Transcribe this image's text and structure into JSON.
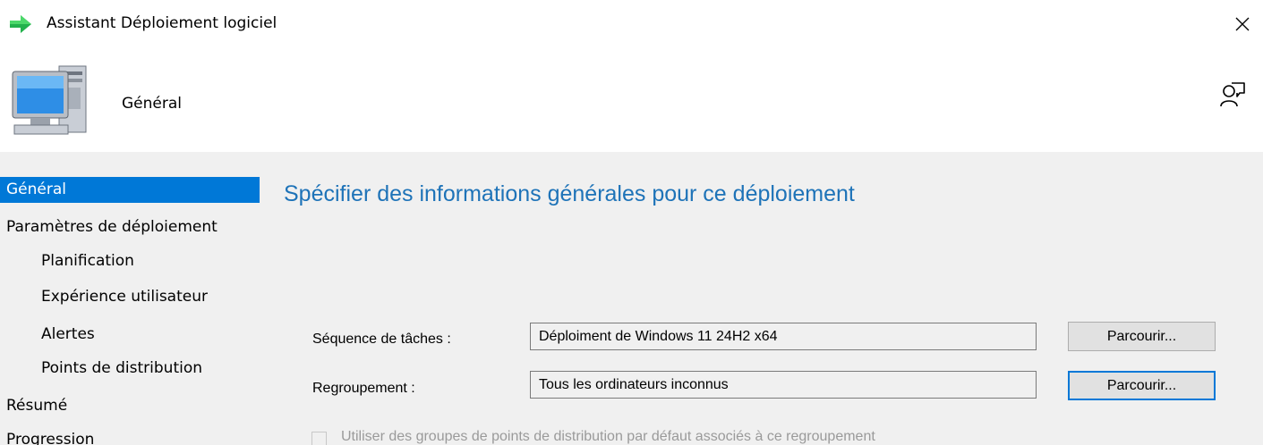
{
  "window": {
    "title": "Assistant Déploiement logiciel",
    "icon": "green-arrow-icon",
    "close_glyph": "✕"
  },
  "header": {
    "title": "Général",
    "icon": "computer-icon",
    "help_icon": "help-person-icon"
  },
  "sidebar": {
    "items": [
      {
        "label": "Général",
        "selected": true,
        "level": 0
      },
      {
        "label": "Paramètres de déploiement",
        "selected": false,
        "level": 0
      },
      {
        "label": "Planification",
        "selected": false,
        "level": 1
      },
      {
        "label": "Expérience utilisateur",
        "selected": false,
        "level": 1
      },
      {
        "label": "Alertes",
        "selected": false,
        "level": 1
      },
      {
        "label": "Points de distribution",
        "selected": false,
        "level": 1
      },
      {
        "label": "Résumé",
        "selected": false,
        "level": 0
      },
      {
        "label": "Progression",
        "selected": false,
        "level": 0
      }
    ]
  },
  "main": {
    "heading": "Spécifier des informations générales pour ce déploiement",
    "task_sequence": {
      "label": "Séquence de tâches :",
      "value": "Déploiment de Windows 11 24H2 x64",
      "browse_label": "Parcourir..."
    },
    "collection": {
      "label": "Regroupement :",
      "value": "Tous les ordinateurs inconnus",
      "browse_label": "Parcourir..."
    },
    "default_dp_groups": {
      "label": "Utiliser des groupes de points de distribution par défaut associés à ce regroupement",
      "checked": false,
      "enabled": false
    }
  },
  "colors": {
    "accent": "#0078d7",
    "heading": "#1e73b8",
    "panel_bg": "#f0f0f0"
  }
}
